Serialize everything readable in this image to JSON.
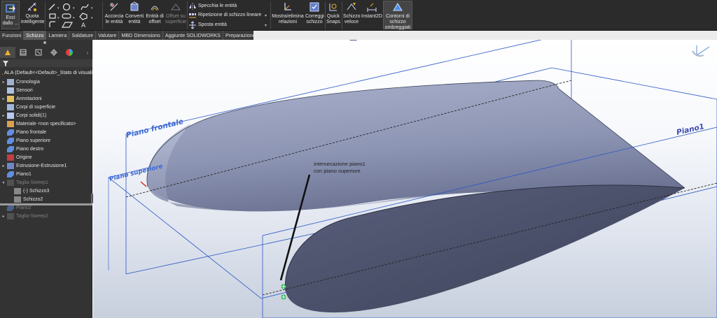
{
  "ribbon": {
    "exit_sketch": "Esci dallo ...",
    "smart_dimension": "Quota intelligente",
    "trim": "Accorcia le entità",
    "convert": "Converti entità",
    "offset": "Entità di offset",
    "offset_surface": "Offset su superficie",
    "mirror": "Specchia le entità",
    "linear_pattern": "Ripetizione di schizzo lineare",
    "move": "Sposta entità",
    "display_relations": "Mostra/elimina relazioni",
    "repair": "Correggi schizzo",
    "quick_snaps": "Quick Snaps",
    "rapid_sketch": "Schizzo veloce",
    "instant2d": "Instant2D",
    "shaded_contours": "Contorni di schizzo ombreggiati"
  },
  "tabs": [
    {
      "label": "Funzioni"
    },
    {
      "label": "Schizzo",
      "active": true
    },
    {
      "label": "Lamiera"
    },
    {
      "label": "Saldature"
    },
    {
      "label": "Valutare"
    },
    {
      "label": "MBD Dimensions"
    },
    {
      "label": "Aggiunte SOLIDWORKS"
    },
    {
      "label": "Preparazione analisi"
    }
  ],
  "tree": {
    "root": "ALA  (Default<<Default>_Stato di visuali",
    "items": [
      {
        "label": "Cronologia",
        "icon": "history-icon"
      },
      {
        "label": "Sensori",
        "icon": "sensor-icon"
      },
      {
        "label": "Annotazioni",
        "icon": "annotation-icon"
      },
      {
        "label": "Corpi di superficie",
        "icon": "surface-bodies-icon"
      },
      {
        "label": "Corpi solidi(1)",
        "icon": "solid-bodies-icon"
      },
      {
        "label": "Materiale <non specificato>",
        "icon": "material-icon"
      },
      {
        "label": "Piano frontale",
        "icon": "plane-icon"
      },
      {
        "label": "Piano superiore",
        "icon": "plane-icon"
      },
      {
        "label": "Piano destro",
        "icon": "plane-icon"
      },
      {
        "label": "Origine",
        "icon": "origin-icon"
      },
      {
        "label": "Estrusione-Estrusione1",
        "icon": "extrude-icon"
      },
      {
        "label": "Piano1",
        "icon": "plane-icon"
      },
      {
        "label": "Taglia-Sweep1",
        "icon": "cut-sweep-icon"
      },
      {
        "label": "(-) Schizzo3",
        "icon": "sketch-icon"
      },
      {
        "label": "Schizzo2",
        "icon": "sketch-icon"
      },
      {
        "label": "Piano2",
        "icon": "plane-icon"
      },
      {
        "label": "Taglia-Sweep2",
        "icon": "cut-sweep-icon"
      }
    ]
  },
  "viewport": {
    "plane_front": "Piano frontale",
    "plane_top": "Piano superiore",
    "plane1": "Piano1",
    "annotation_line1": "intersecazione piano1",
    "annotation_line2": "con piano superiore"
  },
  "colors": {
    "ribbon_bg": "#2b2b2b",
    "panel_bg": "#333333",
    "plane_blue": "#2a56c6",
    "body_light": "#a3abc6",
    "body_dark": "#4a4f68",
    "snap_green": "#22b14c"
  }
}
